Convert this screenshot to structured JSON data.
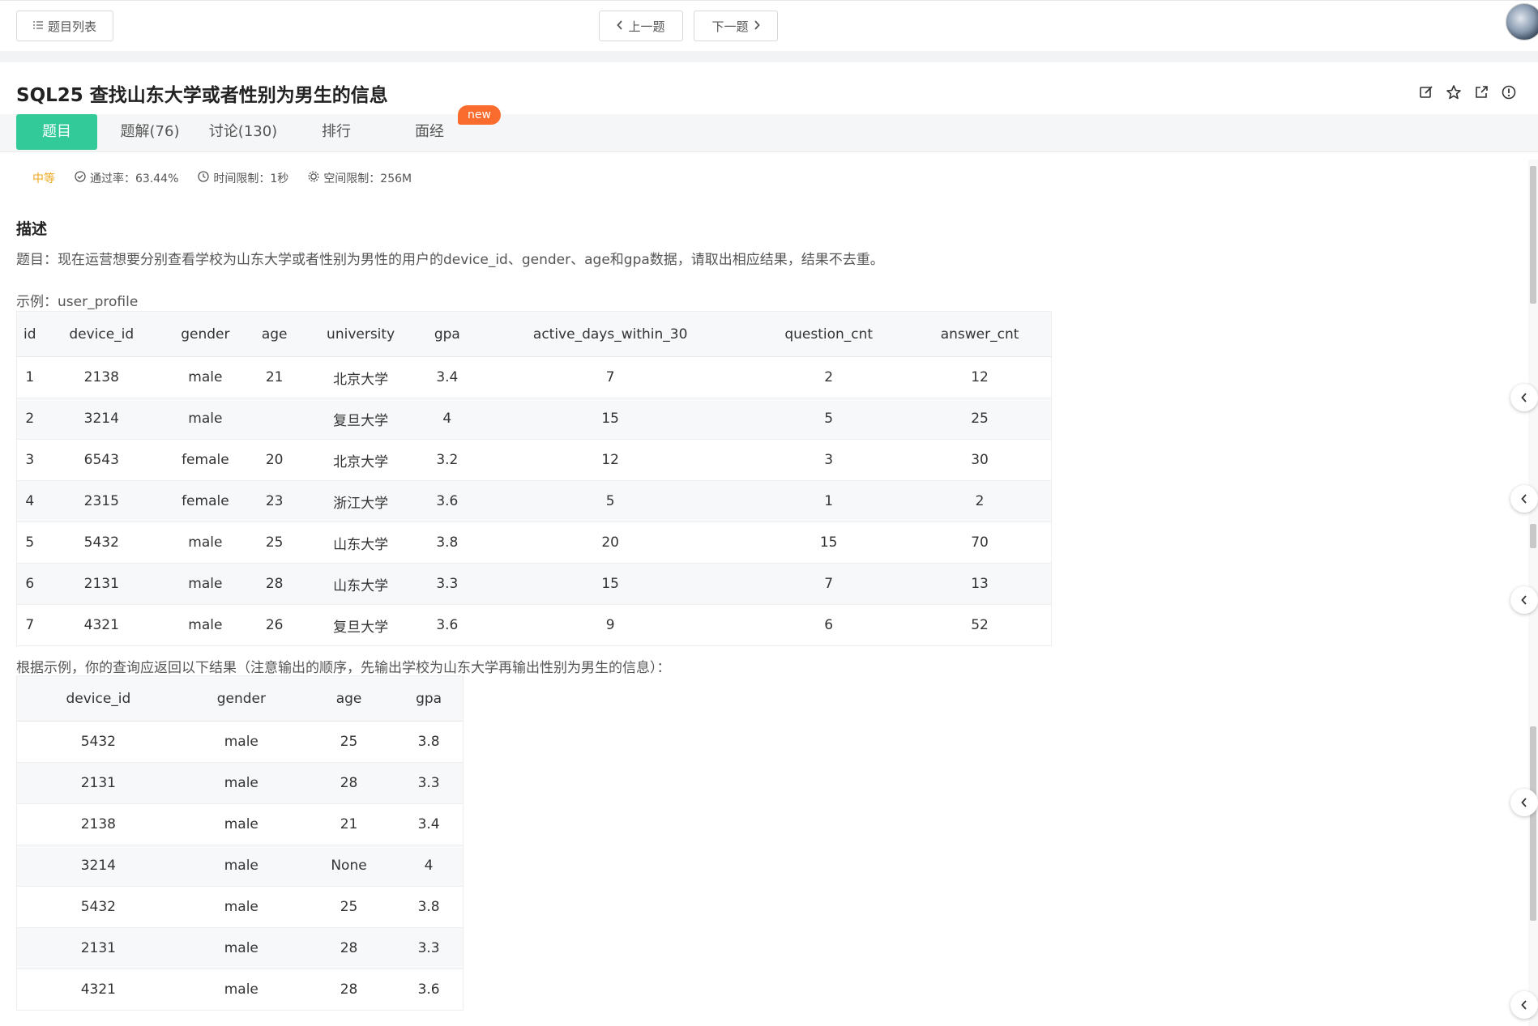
{
  "toolbar": {
    "list_label": "题目列表",
    "prev_label": "上一题",
    "next_label": "下一题"
  },
  "problem": {
    "title": "SQL25  查找山东大学或者性别为男生的信息",
    "tabs": [
      "题目",
      "题解(76)",
      "讨论(130)",
      "排行",
      "面经"
    ],
    "new_badge": "new",
    "difficulty": "中等",
    "pass_rate": "通过率：63.44%",
    "time_limit": "时间限制：1秒",
    "space_limit": "空间限制：256M",
    "desc_heading": "描述",
    "desc_text": "题目：现在运营想要分别查看学校为山东大学或者性别为男性的用户的device_id、gender、age和gpa数据，请取出相应结果，结果不去重。",
    "example_label": "示例：user_profile",
    "result_label": "根据示例，你的查询应返回以下结果（注意输出的顺序，先输出学校为山东大学再输出性别为男生的信息）："
  },
  "table1": {
    "headers": [
      "id",
      "device_id",
      "gender",
      "age",
      "university",
      "gpa",
      "active_days_within_30",
      "question_cnt",
      "answer_cnt"
    ],
    "rows": [
      [
        "1",
        "2138",
        "male",
        "21",
        "北京大学",
        "3.4",
        "7",
        "2",
        "12"
      ],
      [
        "2",
        "3214",
        "male",
        "",
        "复旦大学",
        "4",
        "15",
        "5",
        "25"
      ],
      [
        "3",
        "6543",
        "female",
        "20",
        "北京大学",
        "3.2",
        "12",
        "3",
        "30"
      ],
      [
        "4",
        "2315",
        "female",
        "23",
        "浙江大学",
        "3.6",
        "5",
        "1",
        "2"
      ],
      [
        "5",
        "5432",
        "male",
        "25",
        "山东大学",
        "3.8",
        "20",
        "15",
        "70"
      ],
      [
        "6",
        "2131",
        "male",
        "28",
        "山东大学",
        "3.3",
        "15",
        "7",
        "13"
      ],
      [
        "7",
        "4321",
        "male",
        "26",
        "复旦大学",
        "3.6",
        "9",
        "6",
        "52"
      ]
    ]
  },
  "table2": {
    "headers": [
      "device_id",
      "gender",
      "age",
      "gpa"
    ],
    "rows": [
      [
        "5432",
        "male",
        "25",
        "3.8"
      ],
      [
        "2131",
        "male",
        "28",
        "3.3"
      ],
      [
        "2138",
        "male",
        "21",
        "3.4"
      ],
      [
        "3214",
        "male",
        "None",
        "4"
      ],
      [
        "5432",
        "male",
        "25",
        "3.8"
      ],
      [
        "2131",
        "male",
        "28",
        "3.3"
      ],
      [
        "4321",
        "male",
        "28",
        "3.6"
      ]
    ]
  },
  "colors": {
    "accent": "#32ca99",
    "badge": "#fa6c2d",
    "difficulty": "#f0a71f"
  },
  "icons": [
    "list-icon",
    "chevron-left-icon",
    "chevron-right-icon",
    "edit-icon",
    "star-icon",
    "share-icon",
    "info-icon",
    "check-circle-icon",
    "clock-icon",
    "gear-icon"
  ]
}
